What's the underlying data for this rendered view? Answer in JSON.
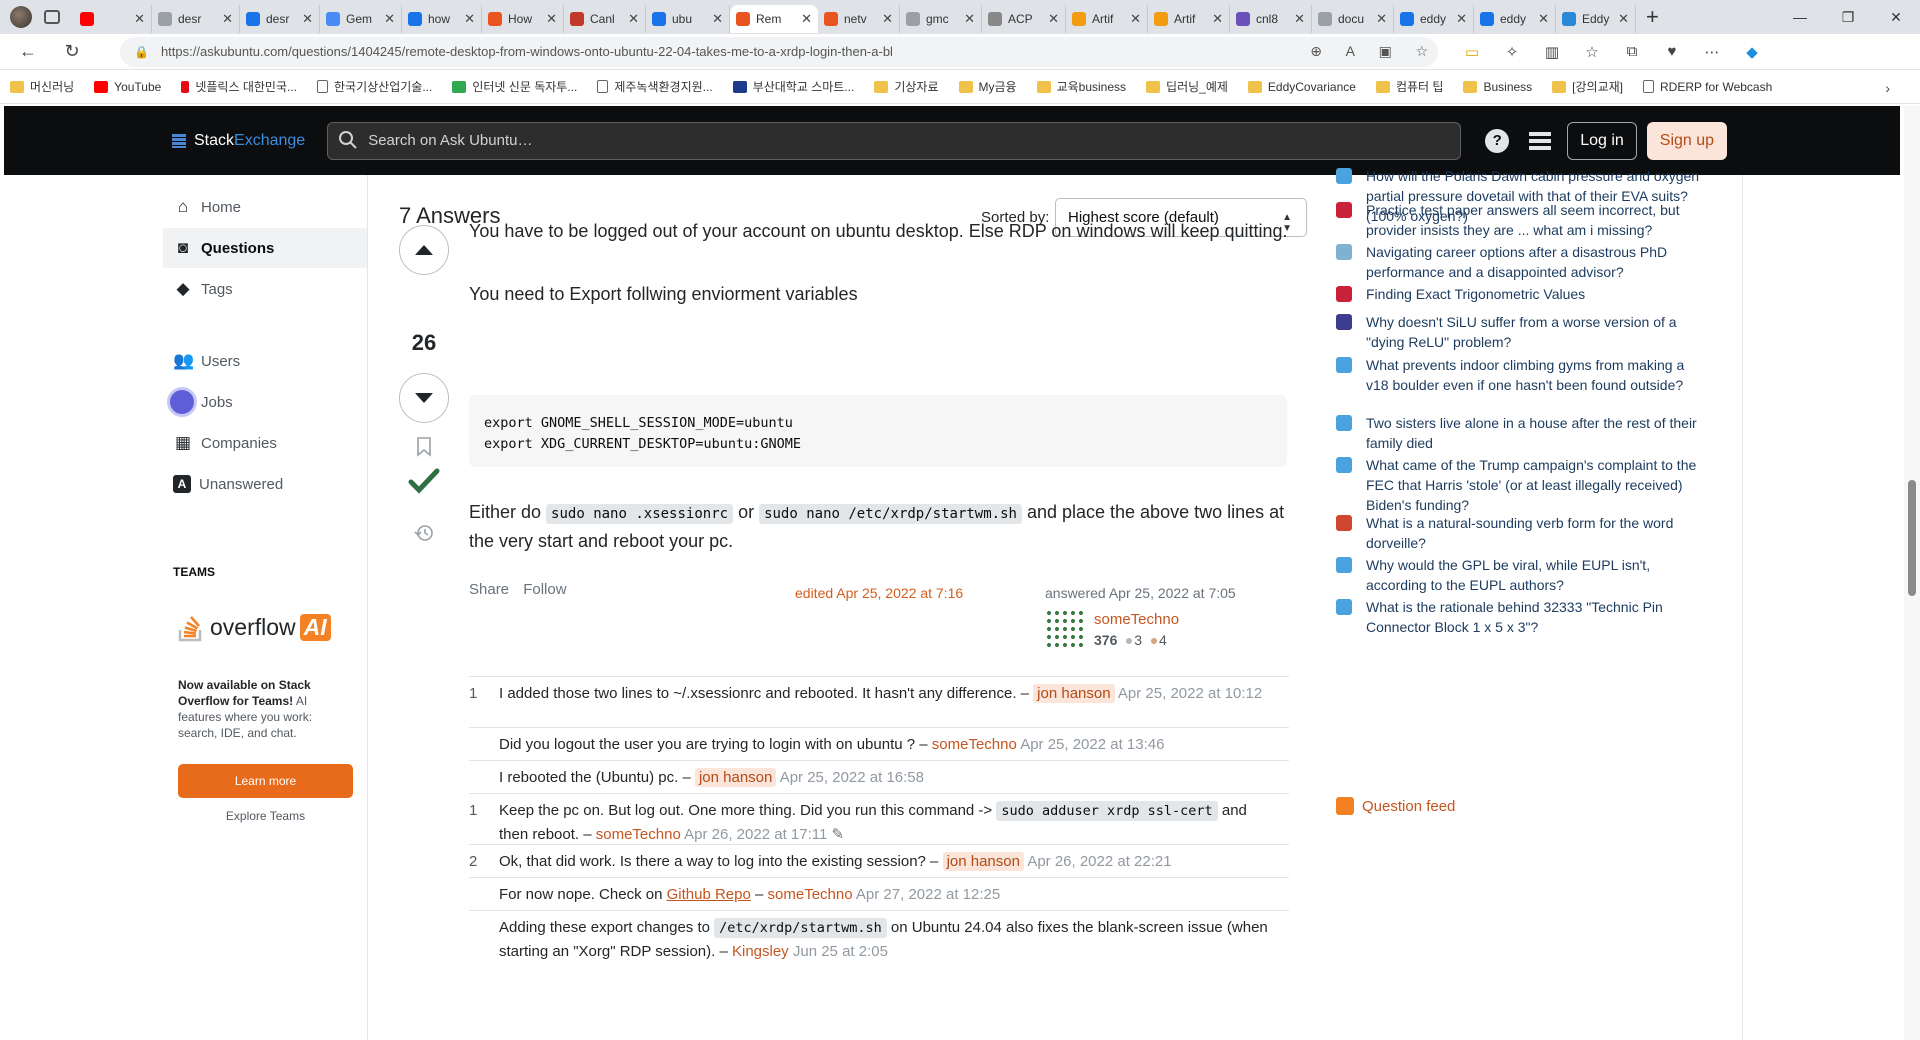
{
  "browser": {
    "tabs": [
      {
        "title": "",
        "color": "#ff0000"
      },
      {
        "title": "desr",
        "color": "#9aa0a6"
      },
      {
        "title": "desr",
        "color": "#1a73e8"
      },
      {
        "title": "Gem",
        "color": "#4b8bf5"
      },
      {
        "title": "how",
        "color": "#1a73e8"
      },
      {
        "title": "How",
        "color": "#e95420"
      },
      {
        "title": "Canl",
        "color": "#c0392b"
      },
      {
        "title": "ubu",
        "color": "#1a73e8"
      },
      {
        "title": "Rem",
        "color": "#e95420",
        "active": true
      },
      {
        "title": "netv",
        "color": "#e95420"
      },
      {
        "title": "gmc",
        "color": "#9aa0a6"
      },
      {
        "title": "ACP",
        "color": "#888888"
      },
      {
        "title": "Artif",
        "color": "#f39c12"
      },
      {
        "title": "Artif",
        "color": "#f39c12"
      },
      {
        "title": "cnl8",
        "color": "#6b4fbb"
      },
      {
        "title": "docu",
        "color": "#9aa0a6"
      },
      {
        "title": "eddy",
        "color": "#1a73e8"
      },
      {
        "title": "eddy",
        "color": "#1a73e8"
      },
      {
        "title": "Eddy",
        "color": "#2a88d8"
      }
    ],
    "url": "https://askubuntu.com/questions/1404245/remote-desktop-from-windows-onto-ubuntu-22-04-takes-me-to-a-xrdp-login-then-a-bl",
    "bookmarks": [
      {
        "label": "머신러닝",
        "kind": "folder"
      },
      {
        "label": "YouTube",
        "kind": "youtube"
      },
      {
        "label": "넷플릭스 대한민국...",
        "kind": "netflix"
      },
      {
        "label": "한국기상산업기술...",
        "kind": "page"
      },
      {
        "label": "인터넷 신문 독자투...",
        "kind": "green"
      },
      {
        "label": "제주녹색환경지원...",
        "kind": "page"
      },
      {
        "label": "부산대학교 스마트...",
        "kind": "p"
      },
      {
        "label": "기상자료",
        "kind": "folder"
      },
      {
        "label": "My금융",
        "kind": "folder"
      },
      {
        "label": "교육business",
        "kind": "folder"
      },
      {
        "label": "딥러닝_예제",
        "kind": "folder"
      },
      {
        "label": "EddyCovariance",
        "kind": "folder"
      },
      {
        "label": "컴퓨터 팁",
        "kind": "folder"
      },
      {
        "label": "Business",
        "kind": "folder"
      },
      {
        "label": "[강의교재]",
        "kind": "folder"
      },
      {
        "label": "RDERP for Webcash",
        "kind": "page"
      }
    ]
  },
  "site": {
    "logo_stack": "Stack",
    "logo_exchange": "Exchange",
    "search_placeholder": "Search on Ask Ubuntu…",
    "help": "?",
    "login": "Log in",
    "signup": "Sign up"
  },
  "leftnav": {
    "items": [
      {
        "label": "Home",
        "icon": "home-icon"
      },
      {
        "label": "Questions",
        "icon": "questions-icon",
        "active": true
      },
      {
        "label": "Tags",
        "icon": "tag-icon"
      },
      {
        "label": "Users",
        "icon": "users-icon"
      },
      {
        "label": "Jobs",
        "icon": "jobs-icon"
      },
      {
        "label": "Companies",
        "icon": "companies-icon"
      },
      {
        "label": "Unanswered",
        "icon": "unanswered-icon"
      }
    ],
    "teams_heading": "TEAMS",
    "overflow_text": "overflow",
    "ai_text": "AI",
    "teams_desc_bold": "Now available on Stack Overflow for Teams!",
    "teams_desc_rest": " AI features where you work: search, IDE, and chat.",
    "learn_more": "Learn more",
    "explore_teams": "Explore Teams"
  },
  "answers": {
    "heading": "7 Answers",
    "sorted_by_label": "Sorted by:",
    "sort_value": "Highest score (default)"
  },
  "answer": {
    "score": "26",
    "p1": "You have to be logged out of your account on ubuntu desktop. Else RDP on windows will keep quitting.",
    "p2": "You need to Export follwing enviorment variables",
    "code": "export GNOME_SHELL_SESSION_MODE=ubuntu\nexport XDG_CURRENT_DESKTOP=ubuntu:GNOME",
    "p3_a": "Either do ",
    "p3_code1": "sudo nano .xsessionrc",
    "p3_b": " or ",
    "p3_code2": "sudo nano /etc/xrdp/startwm.sh",
    "p3_c": " and place the above two lines at the very start and reboot your pc.",
    "share": "Share",
    "follow": "Follow",
    "edited": "edited Apr 25, 2022 at 7:16",
    "answered": "answered Apr 25, 2022 at 7:05",
    "user": "someTechno",
    "rep": "376",
    "silver": "3",
    "bronze": "4"
  },
  "comments": [
    {
      "score": "1",
      "text": "I added those two lines to ~/.xsessionrc and rebooted. It hasn't any difference. – ",
      "user": "jon hanson",
      "op": true,
      "date": "Apr 25, 2022 at 10:12"
    },
    {
      "score": "",
      "text": "Did you logout the user you are trying to login with on ubuntu ? – ",
      "user": "someTechno",
      "op": false,
      "date": "Apr 25, 2022 at 13:46"
    },
    {
      "score": "",
      "text": "I rebooted the (Ubuntu) pc. – ",
      "user": "jon hanson",
      "op": true,
      "date": "Apr 25, 2022 at 16:58"
    },
    {
      "score": "1",
      "text_a": "Keep the pc on. But log out. One more thing. Did you run this command -> ",
      "code": "sudo adduser xrdp ssl-cert",
      "text_b": " and then reboot. – ",
      "user": "someTechno",
      "op": false,
      "date": "Apr 26, 2022 at 17:11"
    },
    {
      "score": "2",
      "text": "Ok, that did work. Is there a way to log into the existing session? – ",
      "user": "jon hanson",
      "op": true,
      "date": "Apr 26, 2022 at 22:21"
    },
    {
      "score": "",
      "text_a": "For now nope. Check on ",
      "link": "Github Repo",
      "text_b": " – ",
      "user": "someTechno",
      "op": false,
      "date": "Apr 27, 2022 at 12:25"
    },
    {
      "score": "",
      "text_a": "Adding these export changes to ",
      "code": "/etc/xrdp/startwm.sh",
      "text_b": " on Ubuntu 24.04 also fixes the blank-screen issue (when starting an \"Xorg\" RDP session). – ",
      "user": "Kingsley",
      "op": false,
      "date": "Jun 25 at 2:05"
    }
  ],
  "hot_questions": [
    {
      "title": "How will the Polaris Dawn cabin pressure and oxygen partial pressure dovetail with that of their EVA suits? (100% oxygen?)",
      "color": "#4aa3df"
    },
    {
      "title": "Practice test paper answers all seem incorrect, but provider insists they are ... what am i missing?",
      "color": "#c9213a"
    },
    {
      "title": "Navigating career options after a disastrous PhD performance and a disappointed advisor?",
      "color": "#7fb1d3"
    },
    {
      "title": "Finding Exact Trigonometric Values",
      "color": "#c9213a"
    },
    {
      "title": "Why doesn't SiLU suffer from a worse version of a \"dying ReLU\" problem?",
      "color": "#3d3d8f"
    },
    {
      "title": "What prevents indoor climbing gyms from making a v18 boulder even if one hasn't been found outside?",
      "color": "#4aa3df"
    },
    {
      "title": "Two sisters live alone in a house after the rest of their family died",
      "color": "#4aa3df"
    },
    {
      "title": "What came of the Trump campaign's complaint to the FEC that Harris 'stole' (or at least illegally received) Biden's funding?",
      "color": "#4aa3df"
    },
    {
      "title": "What is a natural-sounding verb form for the word dorveille?",
      "color": "#d0462e"
    },
    {
      "title": "Why would the GPL be viral, while EUPL isn't, according to the EUPL authors?",
      "color": "#4aa3df"
    },
    {
      "title": "What is the rationale behind 32333 \"Technic Pin Connector Block 1 x 5 x 3\"?",
      "color": "#4aa3df"
    }
  ],
  "question_feed": "Question feed",
  "colors": {
    "accent": "#f48225",
    "link_orange": "#c5551e",
    "accepted": "#2f6f44"
  }
}
